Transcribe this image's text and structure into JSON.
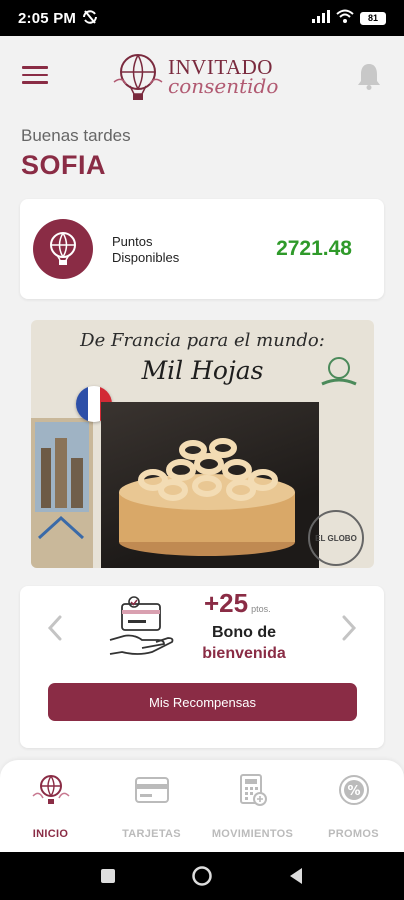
{
  "status_bar": {
    "time": "2:05 PM",
    "battery": "81"
  },
  "header": {
    "logo_line1": "INVITADO",
    "logo_line2": "consentido"
  },
  "greeting": "Buenas tardes",
  "user_name": "SOFIA",
  "points": {
    "label_line1": "Puntos",
    "label_line2": "Disponibles",
    "value": "2721.48"
  },
  "banner": {
    "line1": "De Francia para el mundo:",
    "line2": "Mil Hojas",
    "stamp_text": "EL GLOBO"
  },
  "bonus": {
    "points": "+25",
    "unit": "ptos.",
    "title": "Bono de",
    "subtitle": "bienvenida",
    "button_label": "Mis Recompensas"
  },
  "bottom_nav": {
    "items": [
      {
        "label": "INICIO",
        "icon": "balloon-icon",
        "active": true
      },
      {
        "label": "TARJETAS",
        "icon": "card-icon",
        "active": false
      },
      {
        "label": "MOVIMIENTOS",
        "icon": "calculator-icon",
        "active": false
      },
      {
        "label": "PROMOS",
        "icon": "percent-icon",
        "active": false
      }
    ]
  },
  "colors": {
    "brand": "#8a2c45",
    "points_green": "#2f9a2a",
    "inactive": "#bbbbbb"
  }
}
